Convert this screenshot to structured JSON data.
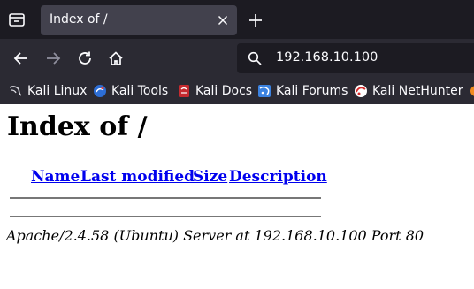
{
  "tab": {
    "title": "Index of /"
  },
  "urlbar": {
    "url": "192.168.10.100"
  },
  "bookmarks": [
    {
      "label": "Kali Linux",
      "icon": "kali-dragon-icon"
    },
    {
      "label": "Kali Tools",
      "icon": "kali-tools-icon"
    },
    {
      "label": "Kali Docs",
      "icon": "kali-docs-icon"
    },
    {
      "label": "Kali Forums",
      "icon": "kali-forums-icon"
    },
    {
      "label": "Kali NetHunter",
      "icon": "kali-nethunter-icon"
    }
  ],
  "page": {
    "heading": "Index of /",
    "columns": [
      "Name",
      "Last modified",
      "Size",
      "Description"
    ],
    "address": "Apache/2.4.58 (Ubuntu) Server at 192.168.10.100 Port 80"
  },
  "colors": {
    "tabbar_bg": "#1c1b22",
    "toolbar_bg": "#2b2a33",
    "active_tab_bg": "#42414d",
    "link": "#0000ee"
  }
}
